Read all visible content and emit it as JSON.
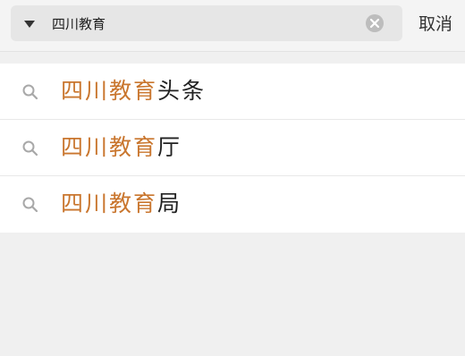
{
  "search": {
    "value": "四川教育",
    "scope_icon": "caret-down-icon",
    "clear_icon": "clear-circle-icon",
    "cancel_label": "取消"
  },
  "suggestions": [
    {
      "icon": "search-icon",
      "match": "四川教育",
      "rest": "头条"
    },
    {
      "icon": "search-icon",
      "match": "四川教育",
      "rest": "厅"
    },
    {
      "icon": "search-icon",
      "match": "四川教育",
      "rest": "局"
    }
  ],
  "colors": {
    "highlight": "#c9762e",
    "background": "#f0f0f0",
    "search_box": "#e6e6e6"
  }
}
